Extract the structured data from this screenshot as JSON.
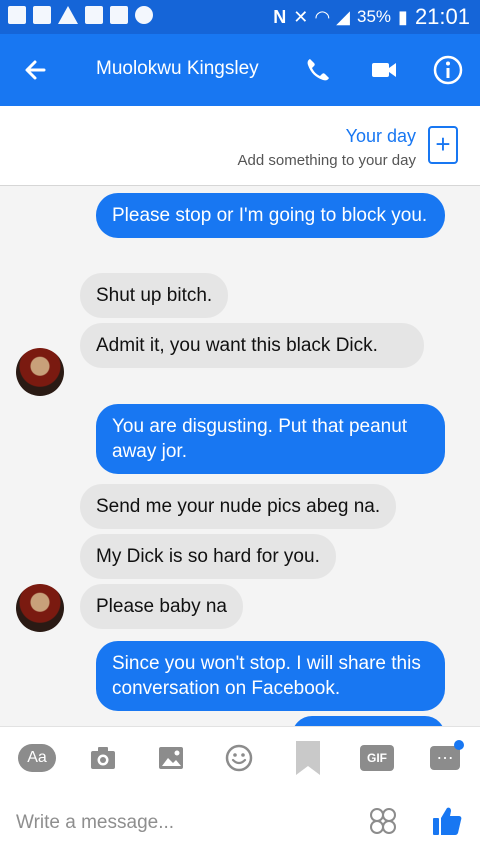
{
  "status_bar": {
    "battery": "35%",
    "time": "21:01",
    "network_label": "N"
  },
  "header": {
    "title": "Muolokwu Kingsley"
  },
  "your_day": {
    "title": "Your day",
    "subtitle": "Add something to your day"
  },
  "messages": [
    {
      "direction": "outgoing",
      "text": "Please stop or I'm going to block you."
    },
    {
      "direction": "incoming",
      "text": "Shut up bitch."
    },
    {
      "direction": "incoming",
      "text": "Admit it, you want this black Dick."
    },
    {
      "direction": "outgoing",
      "text": "You are disgusting. Put that peanut away jor."
    },
    {
      "direction": "incoming",
      "text": "Send me your nude pics abeg na."
    },
    {
      "direction": "incoming",
      "text": "My Dick is so hard for you."
    },
    {
      "direction": "incoming",
      "text": "Please baby na"
    },
    {
      "direction": "outgoing",
      "text": "Since you won't stop. I will share this conversation on Facebook."
    }
  ],
  "composer": {
    "aa_label": "Aa",
    "gif_label": "GIF",
    "placeholder": "Write a message..."
  },
  "colors": {
    "brand": "#1877f2",
    "status_bar": "#1565d8",
    "incoming_bubble": "#e5e5e5",
    "background": "#f4f4f4"
  },
  "icons": [
    "back-arrow-icon",
    "phone-icon",
    "video-camera-icon",
    "info-icon",
    "camera-icon",
    "gallery-icon",
    "emoji-icon",
    "bookmark-icon",
    "more-icon",
    "sticker-icon",
    "thumbs-up-icon"
  ]
}
